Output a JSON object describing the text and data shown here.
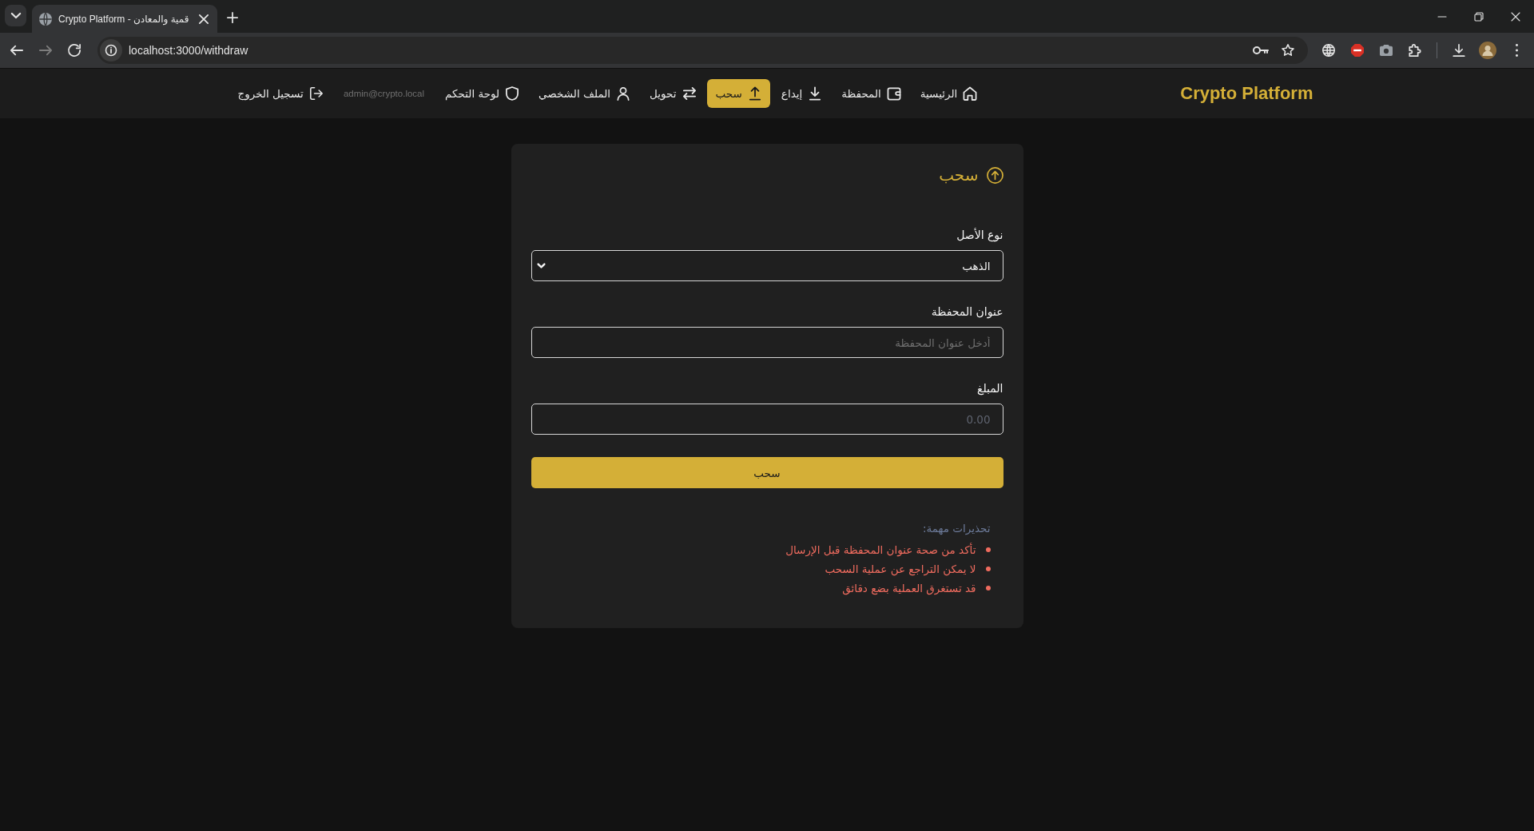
{
  "browser": {
    "tab_title": "Crypto Platform - قمية والمعادن",
    "url": "localhost:3000/withdraw"
  },
  "navbar": {
    "logo": "Crypto Platform",
    "items": [
      {
        "label": "الرئيسية",
        "selected": false
      },
      {
        "label": "المحفظة",
        "selected": false
      },
      {
        "label": "إيداع",
        "selected": false
      },
      {
        "label": "سحب",
        "selected": true
      },
      {
        "label": "تحويل",
        "selected": false
      },
      {
        "label": "الملف الشخصي",
        "selected": false
      },
      {
        "label": "لوحة التحكم",
        "selected": false
      }
    ],
    "user_email": "admin@crypto.local",
    "logout": "تسجيل الخروج"
  },
  "card": {
    "title": "سحب",
    "fields": [
      {
        "kind": "select",
        "label": "نوع الأصل",
        "value": "الذهب"
      },
      {
        "kind": "text",
        "label": "عنوان المحفظة",
        "placeholder": "أدخل عنوان المحفظة"
      },
      {
        "kind": "number",
        "label": "المبلغ",
        "placeholder": "0.00"
      }
    ],
    "submit": "سحب",
    "warnings": {
      "title": "تحذيرات مهمة:",
      "items": [
        "تأكد من صحة عنوان المحفظة قبل الإرسال",
        "لا يمكن التراجع عن عملية السحب",
        "قد تستغرق العملية بضع دقائق"
      ]
    }
  }
}
